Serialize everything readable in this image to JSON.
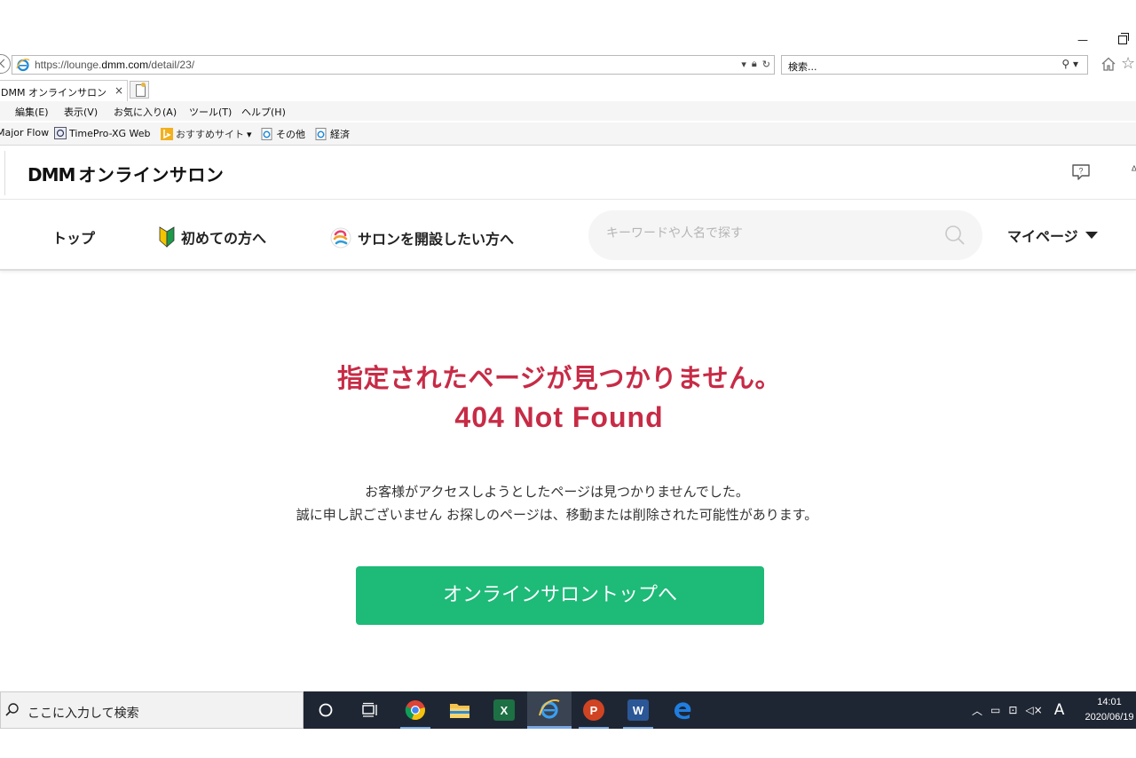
{
  "browser": {
    "url_prefix": "https://lounge.",
    "url_domain": "dmm.com",
    "url_path": "/detail/23/",
    "search_placeholder": "検索...",
    "tab_title": "DMM オンラインサロン",
    "tab_close": "×"
  },
  "menu": {
    "items": [
      "編集(E)",
      "表示(V)",
      "お気に入り(A)",
      "ツール(T)",
      "ヘルプ(H)"
    ]
  },
  "favorites": {
    "items": [
      "Major Flow",
      "TimePro-XG Web",
      "おすすめサイト",
      "その他",
      "経済"
    ]
  },
  "site": {
    "logo_dmm": "DMM",
    "logo_text": "オンラインサロン",
    "nav": {
      "top": "トップ",
      "beginner": "初めての方へ",
      "open_salon": "サロンを開設したい方へ",
      "search_placeholder": "キーワードや人名で探す",
      "mypage": "マイページ"
    }
  },
  "error": {
    "title": "指定されたページが見つかりません。",
    "code": "404 Not Found",
    "message_line1": "お客様がアクセスしようとしたページは見つかりませんでした。",
    "message_line2": "誠に申し訳ございません お探しのページは、移動または削除された可能性があります。",
    "button": "オンラインサロントップへ"
  },
  "taskbar": {
    "search_text": "ここに入力して検索",
    "ime": "A",
    "time": "14:01",
    "date": "2020/06/19"
  },
  "colors": {
    "error_red": "#c72b46",
    "button_green": "#1dba78",
    "taskbar": "#1f2633"
  }
}
